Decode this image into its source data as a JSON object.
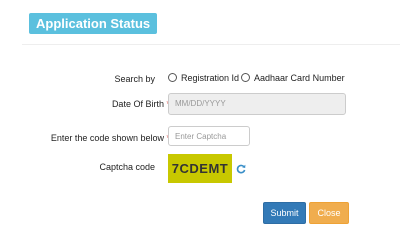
{
  "header": {
    "title": "Application Status"
  },
  "form": {
    "search_by_label": "Search by",
    "options": [
      {
        "label": "Registration Id"
      },
      {
        "label": "Aadhaar Card Number"
      }
    ],
    "dob_label": "Date Of Birth",
    "dob_required_mark": "*",
    "dob_placeholder": "MM/DD/YYYY",
    "code_label": "Enter the code shown below",
    "code_required_mark": "*",
    "code_placeholder": "Enter Captcha",
    "captcha_label": "Captcha code",
    "captcha_value": "7CDEMT",
    "captcha_bg_color": "#c8c800",
    "refresh_icon": "refresh-icon"
  },
  "buttons": {
    "submit_label": "Submit",
    "close_label": "Close",
    "submit_color": "#337ab7",
    "close_color": "#f0ad4e"
  }
}
